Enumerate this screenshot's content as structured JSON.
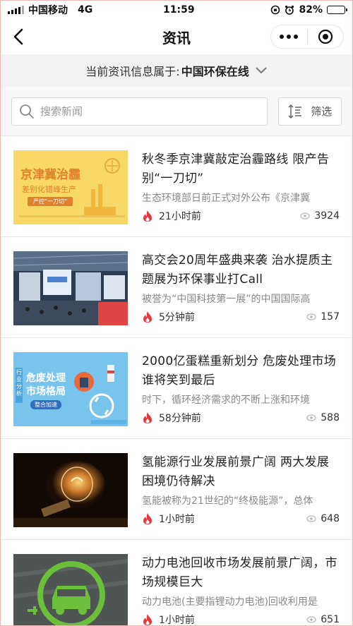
{
  "status": {
    "carrier": "中国移动",
    "network": "4G",
    "time": "11:59",
    "battery_text": "82%",
    "battery_level": 0.82
  },
  "nav": {
    "title": "资讯",
    "back_icon": "chevron-left-icon",
    "more_icon": "more-dots-icon",
    "close_icon": "record-circle-icon"
  },
  "source": {
    "prefix": "当前资讯信息属于:",
    "name": "中国环保在线"
  },
  "search": {
    "placeholder": "搜索新闻",
    "filter_label": "筛选"
  },
  "colors": {
    "flame": "#e8383d",
    "eye": "#b5b5b5",
    "accent_green": "#6bbf3b"
  },
  "news": [
    {
      "title": "秋冬季京津冀敲定治霾路线 限产告别“一刀切”",
      "summary": "生态环境部日前正式对外公布《京津冀",
      "time": "21小时前",
      "views": "3924",
      "thumb": {
        "headline": "京津冀治霾",
        "sub": "差别化错峰生产",
        "tag": "严控“一刀切”"
      }
    },
    {
      "title": "高交会20周年盛典来袭 治水提质主题展为环保事业打Call",
      "summary": "被誉为“中国科技第一展”的中国国际高",
      "time": "5分钟前",
      "views": "157",
      "thumb": {}
    },
    {
      "title": "2000亿蛋糕重新划分 危废处理市场谁将笑到最后",
      "summary": "时下，循环经济需求的不断上涨和环境",
      "time": "58分钟前",
      "views": "588",
      "thumb": {
        "side": "行业分析",
        "headline_1": "危废处理",
        "headline_2": "市场格局",
        "tag": "整合加速"
      }
    },
    {
      "title": "氢能源行业发展前景广阔 两大发展困境仍待解决",
      "summary": "氢能被称为21世纪的“终极能源”，总体",
      "time": "1小时前",
      "views": "648",
      "thumb": {}
    },
    {
      "title": "动力电池回收市场发展前景广阔，市场规模巨大",
      "summary": "动力电池(主要指锂动力电池)回收利用是",
      "time": "1小时前",
      "views": "651",
      "thumb": {}
    }
  ]
}
